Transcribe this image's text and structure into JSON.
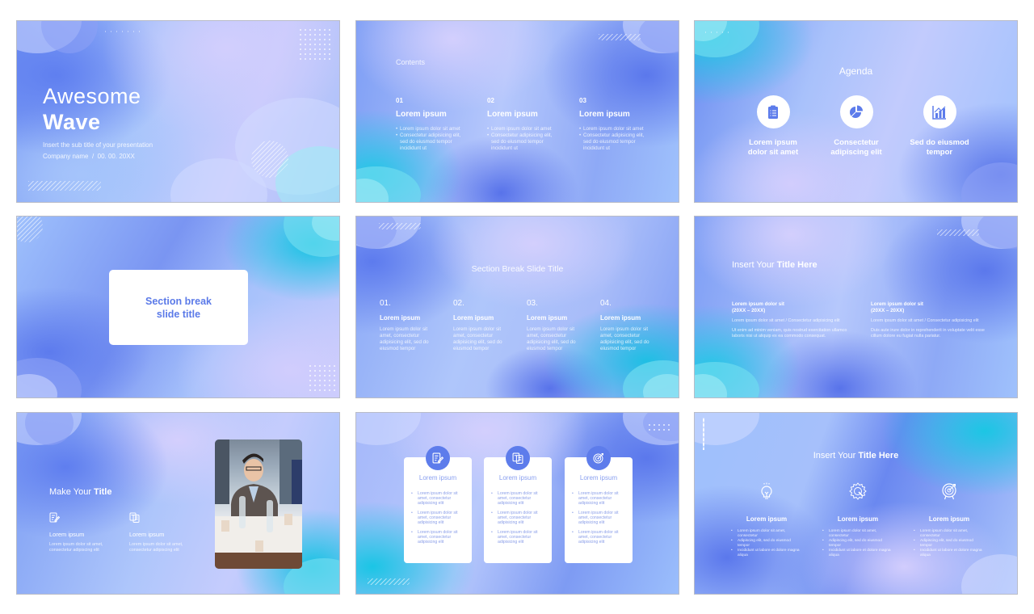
{
  "slides": [
    {
      "title_light": "Awesome",
      "title_bold": "Wave",
      "subtitle": "Insert the sub title of your presentation",
      "company": "Company name",
      "separator": "/",
      "date": "00. 00. 20XX"
    },
    {
      "heading": "Contents",
      "columns": [
        {
          "num": "01",
          "title": "Lorem ipsum",
          "bullets": [
            "Lorem ipsum dolor sit amet",
            "Consectetur adipisicing elit, sed do eiusmod tempor incididunt ut"
          ]
        },
        {
          "num": "02",
          "title": "Lorem ipsum",
          "bullets": [
            "Lorem ipsum dolor sit amet",
            "Consectetur adipisicing elit, sed do eiusmod tempor incididunt ut"
          ]
        },
        {
          "num": "03",
          "title": "Lorem ipsum",
          "bullets": [
            "Lorem ipsum dolor sit amet",
            "Consectetur adipisicing elit, sed do eiusmod tempor incididunt ut"
          ]
        }
      ]
    },
    {
      "heading": "Agenda",
      "items": [
        {
          "icon": "clipboard-checklist-icon",
          "label_1": "Lorem ipsum",
          "label_2": "dolor sit amet"
        },
        {
          "icon": "pie-chart-icon",
          "label_1": "Consectetur",
          "label_2": "adipiscing elit"
        },
        {
          "icon": "bar-chart-growth-icon",
          "label_1": "Sed do eiusmod",
          "label_2": "tempor"
        }
      ]
    },
    {
      "card_line_1": "Section break",
      "card_line_2": "slide title"
    },
    {
      "heading": "Section Break Slide Title",
      "columns": [
        {
          "num": "01.",
          "title": "Lorem ipsum",
          "body": "Lorem ipsum dolor sit amet, consectetur adipisicing elit, sed do eiusmod tempor"
        },
        {
          "num": "02.",
          "title": "Lorem ipsum",
          "body": "Lorem ipsum dolor sit amet, consectetur adipisicing elit, sed do eiusmod tempor"
        },
        {
          "num": "03.",
          "title": "Lorem ipsum",
          "body": "Lorem ipsum dolor sit amet, consectetur adipisicing elit, sed do eiusmod tempor"
        },
        {
          "num": "04.",
          "title": "Lorem ipsum",
          "body": "Lorem ipsum dolor sit amet, consectetur adipisicing elit, sed do eiusmod tempor"
        }
      ]
    },
    {
      "heading_light": "Insert Your ",
      "heading_bold": "Title Here",
      "columns": [
        {
          "title_1": "Lorem ipsum dolor sit",
          "title_2": "(20XX – 20XX)",
          "p1": "Lorem ipsum dolor sit amet / Consectetur adipisicing elit",
          "p2": "Ut enim ad minim veniam, quis nostrud exercitation ullamco laboris nisi ut aliquip ex ea commodo consequat."
        },
        {
          "title_1": "Lorem ipsum dolor sit",
          "title_2": "(20XX – 20XX)",
          "p1": "Lorem ipsum dolor sit amet / Consectetur adipisicing elit",
          "p2": "Duis aute irure dolor in reprehenderit in voluptate velit esse cillum dolore eu fugiat nulla pariatur."
        }
      ]
    },
    {
      "heading_light": "Make Your ",
      "heading_bold": "Title",
      "columns": [
        {
          "icon": "document-edit-icon",
          "title": "Lorem ipsum",
          "body": "Lorem ipsum dolor sit amet, consectetur adipiscing elit"
        },
        {
          "icon": "documents-icon",
          "title": "Lorem ipsum",
          "body": "Lorem ipsum dolor sit amet, consectetur adipiscing elit"
        }
      ],
      "photo": "business-meeting-photo"
    },
    {
      "cards": [
        {
          "icon": "document-edit-icon",
          "title": "Lorem ipsum",
          "bullets": [
            "Lorem ipsum dolor sit amet, consectetur adipisicing elit",
            "Lorem ipsum dolor sit amet, consectetur adipisicing elit",
            "Lorem ipsum dolor sit amet, consectetur adipisicing elit"
          ]
        },
        {
          "icon": "documents-icon",
          "title": "Lorem ipsum",
          "bullets": [
            "Lorem ipsum dolor sit amet, consectetur adipisicing elit",
            "Lorem ipsum dolor sit amet, consectetur adipisicing elit",
            "Lorem ipsum dolor sit amet, consectetur adipisicing elit"
          ]
        },
        {
          "icon": "target-icon",
          "title": "Lorem ipsum",
          "bullets": [
            "Lorem ipsum dolor sit amet, consectetur adipisicing elit",
            "Lorem ipsum dolor sit amet, consectetur adipisicing elit",
            "Lorem ipsum dolor sit amet, consectetur adipisicing elit"
          ]
        }
      ]
    },
    {
      "heading_light": "Insert Your ",
      "heading_bold": "Title Here",
      "columns": [
        {
          "icon": "lightbulb-icon",
          "title": "Lorem ipsum",
          "bullets": [
            "Lorem ipsum dolor sit amet, consectetur",
            "Adipiscing elit, sed do eiusmod tempor",
            "Incididunt ut labore et dolore magna aliqua"
          ]
        },
        {
          "icon": "gear-wrench-icon",
          "title": "Lorem ipsum",
          "bullets": [
            "Lorem ipsum dolor sit amet, consectetur",
            "Adipiscing elit, sed do eiusmod tempor",
            "Incididunt ut labore et dolore magna aliqua"
          ]
        },
        {
          "icon": "target-icon",
          "title": "Lorem ipsum",
          "bullets": [
            "Lorem ipsum dolor sit amet, consectetur",
            "Adipiscing elit, sed do eiusmod tempor",
            "Incididunt ut labore et dolore magna aliqua"
          ]
        }
      ]
    }
  ],
  "colors": {
    "accent": "#5d7ceb",
    "card_title": "#5b7ae8",
    "cyan": "#1cc6e4",
    "lavender": "#d2cefd"
  }
}
